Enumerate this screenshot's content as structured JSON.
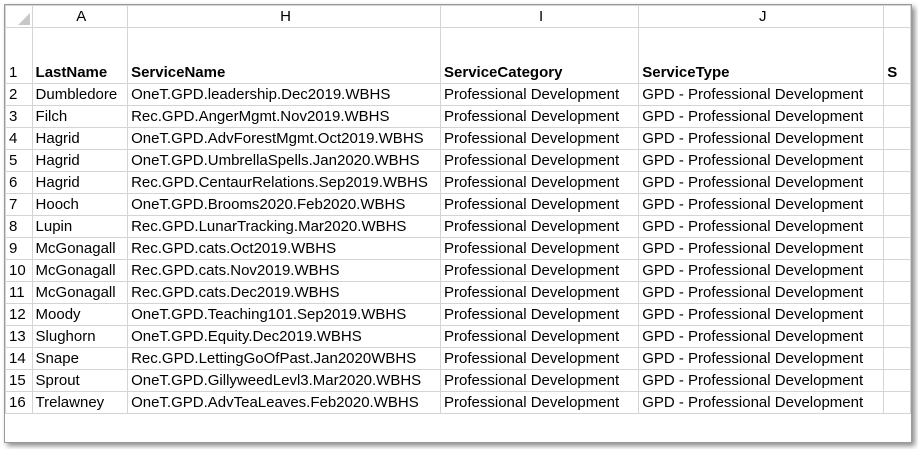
{
  "columns": [
    "A",
    "H",
    "I",
    "J"
  ],
  "partial_header_text": "S",
  "headers": {
    "row_num": "1",
    "last_name": "LastName",
    "service_name": "ServiceName",
    "service_category": "ServiceCategory",
    "service_type": "ServiceType"
  },
  "rows": [
    {
      "n": "2",
      "last": "Dumbledore",
      "service": "OneT.GPD.leadership.Dec2019.WBHS",
      "category": "Professional Development",
      "type": "GPD - Professional Development"
    },
    {
      "n": "3",
      "last": "Filch",
      "service": "Rec.GPD.AngerMgmt.Nov2019.WBHS",
      "category": "Professional Development",
      "type": "GPD - Professional Development"
    },
    {
      "n": "4",
      "last": "Hagrid",
      "service": "OneT.GPD.AdvForestMgmt.Oct2019.WBHS",
      "category": "Professional Development",
      "type": "GPD - Professional Development"
    },
    {
      "n": "5",
      "last": "Hagrid",
      "service": "OneT.GPD.UmbrellaSpells.Jan2020.WBHS",
      "category": "Professional Development",
      "type": "GPD - Professional Development"
    },
    {
      "n": "6",
      "last": "Hagrid",
      "service": "Rec.GPD.CentaurRelations.Sep2019.WBHS",
      "category": "Professional Development",
      "type": "GPD - Professional Development"
    },
    {
      "n": "7",
      "last": "Hooch",
      "service": "OneT.GPD.Brooms2020.Feb2020.WBHS",
      "category": "Professional Development",
      "type": "GPD - Professional Development"
    },
    {
      "n": "8",
      "last": "Lupin",
      "service": "Rec.GPD.LunarTracking.Mar2020.WBHS",
      "category": "Professional Development",
      "type": "GPD - Professional Development"
    },
    {
      "n": "9",
      "last": "McGonagall",
      "service": "Rec.GPD.cats.Oct2019.WBHS",
      "category": "Professional Development",
      "type": "GPD - Professional Development"
    },
    {
      "n": "10",
      "last": "McGonagall",
      "service": "Rec.GPD.cats.Nov2019.WBHS",
      "category": "Professional Development",
      "type": "GPD - Professional Development"
    },
    {
      "n": "11",
      "last": "McGonagall",
      "service": "Rec.GPD.cats.Dec2019.WBHS",
      "category": "Professional Development",
      "type": "GPD - Professional Development"
    },
    {
      "n": "12",
      "last": "Moody",
      "service": "OneT.GPD.Teaching101.Sep2019.WBHS",
      "category": "Professional Development",
      "type": "GPD - Professional Development"
    },
    {
      "n": "13",
      "last": "Slughorn",
      "service": "OneT.GPD.Equity.Dec2019.WBHS",
      "category": "Professional Development",
      "type": "GPD - Professional Development"
    },
    {
      "n": "14",
      "last": "Snape",
      "service": "Rec.GPD.LettingGoOfPast.Jan2020WBHS",
      "category": "Professional Development",
      "type": "GPD - Professional Development"
    },
    {
      "n": "15",
      "last": "Sprout",
      "service": "OneT.GPD.GillyweedLevl3.Mar2020.WBHS",
      "category": "Professional Development",
      "type": "GPD - Professional Development"
    },
    {
      "n": "16",
      "last": "Trelawney",
      "service": "OneT.GPD.AdvTeaLeaves.Feb2020.WBHS",
      "category": "Professional Development",
      "type": "GPD - Professional Development"
    }
  ]
}
